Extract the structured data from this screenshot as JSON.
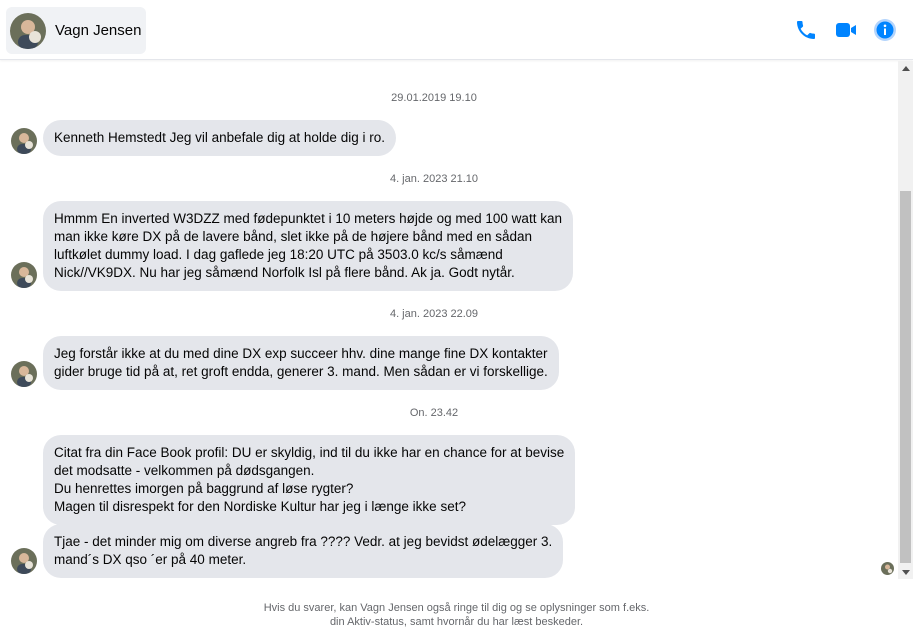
{
  "header": {
    "contact_name": "Vagn Jensen",
    "accent_color": "#0084ff",
    "icons": [
      "phone-icon",
      "video-camera-icon",
      "info-icon"
    ]
  },
  "messages": [
    {
      "timestamp": "29.01.2019 19.10",
      "bubbles": [
        {
          "lines": [
            "Kenneth Hemstedt Jeg vil anbefale dig at holde dig i ro."
          ]
        }
      ]
    },
    {
      "timestamp": "4. jan. 2023 21.10",
      "bubbles": [
        {
          "lines": [
            "Hmmm En inverted W3DZZ med fødepunktet i 10 meters højde og med 100 watt kan",
            "man ikke køre DX på de lavere bånd, slet ikke på de højere bånd med en sådan",
            "luftkølet dummy load. I dag gaflede jeg 18:20 UTC på 3503.0 kc/s såmænd",
            "Nick//VK9DX. Nu har jeg såmænd Norfolk Isl på flere bånd. Ak ja. Godt nytår."
          ]
        }
      ]
    },
    {
      "timestamp": "4. jan. 2023 22.09",
      "bubbles": [
        {
          "lines": [
            "Jeg forstår ikke at du med dine DX exp succeer hhv. dine mange fine DX kontakter",
            "gider bruge tid på at, ret groft endda, generer 3. mand. Men sådan er vi forskellige."
          ]
        }
      ]
    },
    {
      "timestamp": "On. 23.42",
      "bubbles": [
        {
          "lines": [
            "Citat fra din Face Book profil: DU er skyldig, ind til du ikke har en chance for at bevise",
            "det modsatte - velkommen på dødsgangen.",
            "Du henrettes imorgen på baggrund af løse rygter?",
            "Magen til disrespekt for den Nordiske Kultur har jeg i længe ikke set?"
          ]
        },
        {
          "lines": [
            "Tjae - det minder mig om diverse angreb fra ???? Vedr. at jeg bevidst ødelægger 3.",
            "mand´s DX qso ´er på 40 meter."
          ]
        }
      ]
    }
  ],
  "footer": {
    "line1": "Hvis du svarer, kan Vagn Jensen også ringe til dig og se oplysninger som f.eks.",
    "line2": "din Aktiv-status, samt hvornår du har læst beskeder."
  }
}
